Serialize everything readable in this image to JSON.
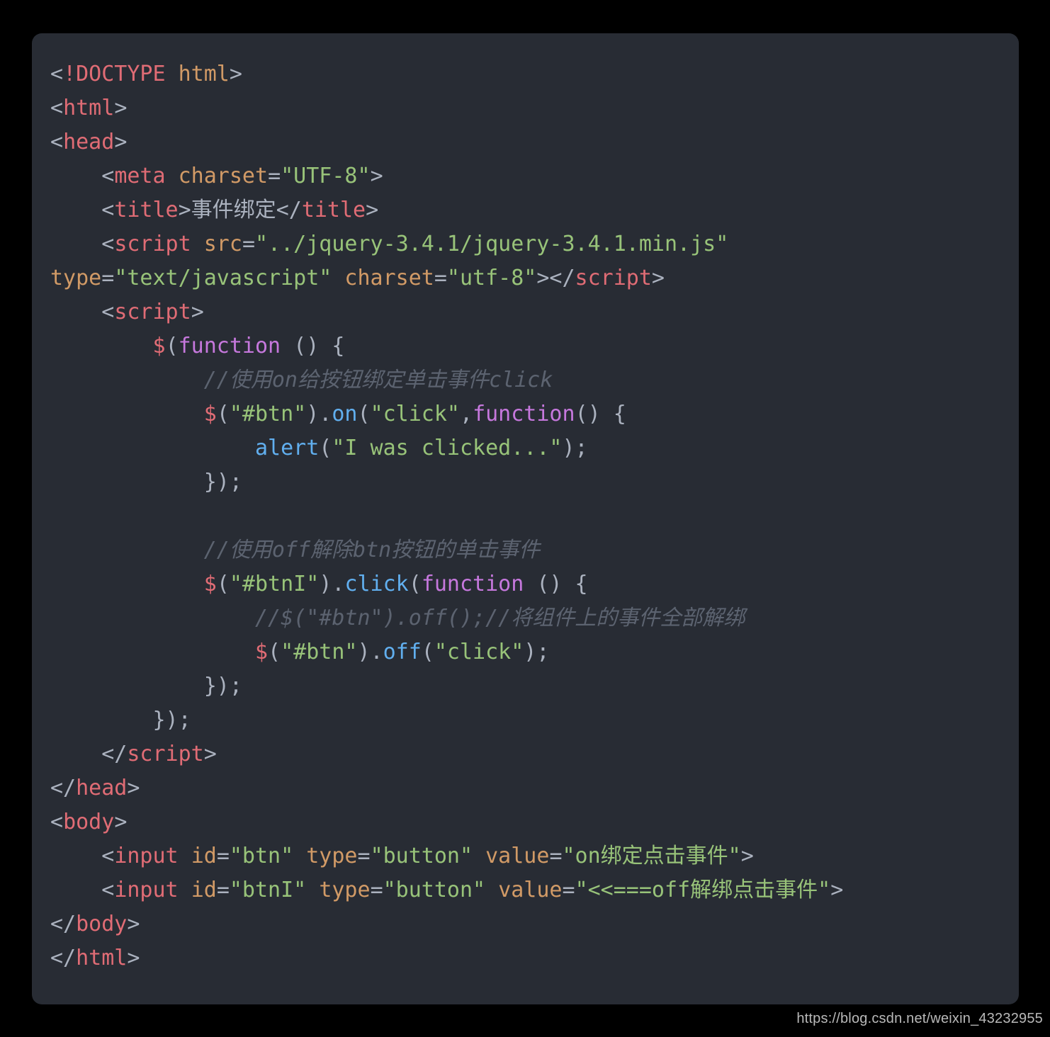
{
  "panel": {
    "background": "#282c34",
    "page_background": "#000000"
  },
  "theme": {
    "punctuation": "#abb2bf",
    "tag": "#e06c75",
    "attribute": "#d19a66",
    "string": "#98c379",
    "method": "#61afef",
    "keyword": "#c678dd",
    "comment": "#5c6370",
    "text": "#abb2bf"
  },
  "watermark": {
    "text": "https://blog.csdn.net/weixin_43232955"
  },
  "code": {
    "language": "html",
    "full_text": "<!DOCTYPE html>\n<html>\n<head>\n    <meta charset=\"UTF-8\">\n    <title>事件绑定</title>\n    <script src=\"../jquery-3.4.1/jquery-3.4.1.min.js\" type=\"text/javascript\" charset=\"utf-8\"></script>\n    <script>\n        $(function () {\n            //使用on给按钮绑定单击事件click\n            $(\"#btn\").on(\"click\",function() {\n                alert(\"I was clicked...\");\n            });\n\n            //使用off解除btn按钮的单击事件\n            $(\"#btnI\").click(function () {\n                //$(\"#btn\").off();//将组件上的事件全部解绑\n                $(\"#btn\").off(\"click\");\n            });\n        });\n    </script>\n</head>\n<body>\n    <input id=\"btn\" type=\"button\" value=\"on绑定点击事件\">\n    <input id=\"btnI\" type=\"button\" value=\"<<===off解绑点击事件\">\n</body>\n</html>",
    "lines": [
      {
        "id": "l1",
        "tokens": [
          {
            "t": "punct",
            "v": "<"
          },
          {
            "t": "tag",
            "v": "!DOCTYPE"
          },
          {
            "t": "txt",
            "v": " "
          },
          {
            "t": "attr",
            "v": "html"
          },
          {
            "t": "punct",
            "v": ">"
          }
        ]
      },
      {
        "id": "l2",
        "tokens": [
          {
            "t": "punct",
            "v": "<"
          },
          {
            "t": "tag",
            "v": "html"
          },
          {
            "t": "punct",
            "v": ">"
          }
        ]
      },
      {
        "id": "l3",
        "tokens": [
          {
            "t": "punct",
            "v": "<"
          },
          {
            "t": "tag",
            "v": "head"
          },
          {
            "t": "punct",
            "v": ">"
          }
        ]
      },
      {
        "id": "l4",
        "tokens": [
          {
            "t": "txt",
            "v": "    "
          },
          {
            "t": "punct",
            "v": "<"
          },
          {
            "t": "tag",
            "v": "meta"
          },
          {
            "t": "txt",
            "v": " "
          },
          {
            "t": "attr",
            "v": "charset"
          },
          {
            "t": "punct",
            "v": "="
          },
          {
            "t": "str",
            "v": "\"UTF-8\""
          },
          {
            "t": "punct",
            "v": ">"
          }
        ]
      },
      {
        "id": "l5",
        "tokens": [
          {
            "t": "txt",
            "v": "    "
          },
          {
            "t": "punct",
            "v": "<"
          },
          {
            "t": "tag",
            "v": "title"
          },
          {
            "t": "punct",
            "v": ">"
          },
          {
            "t": "txt",
            "v": "事件绑定"
          },
          {
            "t": "punct",
            "v": "</"
          },
          {
            "t": "tag",
            "v": "title"
          },
          {
            "t": "punct",
            "v": ">"
          }
        ]
      },
      {
        "id": "l6",
        "tokens": [
          {
            "t": "txt",
            "v": "    "
          },
          {
            "t": "punct",
            "v": "<"
          },
          {
            "t": "tag",
            "v": "script"
          },
          {
            "t": "txt",
            "v": " "
          },
          {
            "t": "attr",
            "v": "src"
          },
          {
            "t": "punct",
            "v": "="
          },
          {
            "t": "str",
            "v": "\"../jquery-3.4.1/jquery-3.4.1.min.js\""
          },
          {
            "t": "txt",
            "v": " "
          },
          {
            "t": "attr",
            "v": "type"
          },
          {
            "t": "punct",
            "v": "="
          },
          {
            "t": "str",
            "v": "\"text/javascript\""
          },
          {
            "t": "txt",
            "v": " "
          },
          {
            "t": "attr",
            "v": "charset"
          },
          {
            "t": "punct",
            "v": "="
          },
          {
            "t": "str",
            "v": "\"utf-8\""
          },
          {
            "t": "punct",
            "v": ">"
          },
          {
            "t": "punct",
            "v": "</"
          },
          {
            "t": "tag",
            "v": "script"
          },
          {
            "t": "punct",
            "v": ">"
          }
        ]
      },
      {
        "id": "l7",
        "tokens": [
          {
            "t": "txt",
            "v": "    "
          },
          {
            "t": "punct",
            "v": "<"
          },
          {
            "t": "tag",
            "v": "script"
          },
          {
            "t": "punct",
            "v": ">"
          }
        ]
      },
      {
        "id": "l8",
        "tokens": [
          {
            "t": "txt",
            "v": "        "
          },
          {
            "t": "sigil",
            "v": "$"
          },
          {
            "t": "punct",
            "v": "("
          },
          {
            "t": "kw",
            "v": "function"
          },
          {
            "t": "txt",
            "v": " "
          },
          {
            "t": "punct",
            "v": "() {"
          }
        ]
      },
      {
        "id": "l9",
        "tokens": [
          {
            "t": "txt",
            "v": "            "
          },
          {
            "t": "cmt",
            "v": "//使用on给按钮绑定单击事件click"
          }
        ]
      },
      {
        "id": "l10",
        "tokens": [
          {
            "t": "txt",
            "v": "            "
          },
          {
            "t": "sigil",
            "v": "$"
          },
          {
            "t": "punct",
            "v": "("
          },
          {
            "t": "str",
            "v": "\"#btn\""
          },
          {
            "t": "punct",
            "v": ")."
          },
          {
            "t": "method",
            "v": "on"
          },
          {
            "t": "punct",
            "v": "("
          },
          {
            "t": "str",
            "v": "\"click\""
          },
          {
            "t": "punct",
            "v": ","
          },
          {
            "t": "kw",
            "v": "function"
          },
          {
            "t": "punct",
            "v": "() {"
          }
        ]
      },
      {
        "id": "l11",
        "tokens": [
          {
            "t": "txt",
            "v": "                "
          },
          {
            "t": "method",
            "v": "alert"
          },
          {
            "t": "punct",
            "v": "("
          },
          {
            "t": "str",
            "v": "\"I was clicked...\""
          },
          {
            "t": "punct",
            "v": ");"
          }
        ]
      },
      {
        "id": "l12",
        "tokens": [
          {
            "t": "txt",
            "v": "            "
          },
          {
            "t": "punct",
            "v": "});"
          }
        ]
      },
      {
        "id": "l13",
        "tokens": []
      },
      {
        "id": "l14",
        "tokens": [
          {
            "t": "txt",
            "v": "            "
          },
          {
            "t": "cmt",
            "v": "//使用off解除btn按钮的单击事件"
          }
        ]
      },
      {
        "id": "l15",
        "tokens": [
          {
            "t": "txt",
            "v": "            "
          },
          {
            "t": "sigil",
            "v": "$"
          },
          {
            "t": "punct",
            "v": "("
          },
          {
            "t": "str",
            "v": "\"#btnI\""
          },
          {
            "t": "punct",
            "v": ")."
          },
          {
            "t": "method",
            "v": "click"
          },
          {
            "t": "punct",
            "v": "("
          },
          {
            "t": "kw",
            "v": "function"
          },
          {
            "t": "txt",
            "v": " "
          },
          {
            "t": "punct",
            "v": "() {"
          }
        ]
      },
      {
        "id": "l16",
        "tokens": [
          {
            "t": "txt",
            "v": "                "
          },
          {
            "t": "cmt",
            "v": "//$(\"#btn\").off();//将组件上的事件全部解绑"
          }
        ]
      },
      {
        "id": "l17",
        "tokens": [
          {
            "t": "txt",
            "v": "                "
          },
          {
            "t": "sigil",
            "v": "$"
          },
          {
            "t": "punct",
            "v": "("
          },
          {
            "t": "str",
            "v": "\"#btn\""
          },
          {
            "t": "punct",
            "v": ")."
          },
          {
            "t": "method",
            "v": "off"
          },
          {
            "t": "punct",
            "v": "("
          },
          {
            "t": "str",
            "v": "\"click\""
          },
          {
            "t": "punct",
            "v": ");"
          }
        ]
      },
      {
        "id": "l18",
        "tokens": [
          {
            "t": "txt",
            "v": "            "
          },
          {
            "t": "punct",
            "v": "});"
          }
        ]
      },
      {
        "id": "l19",
        "tokens": [
          {
            "t": "txt",
            "v": "        "
          },
          {
            "t": "punct",
            "v": "});"
          }
        ]
      },
      {
        "id": "l20",
        "tokens": [
          {
            "t": "txt",
            "v": "    "
          },
          {
            "t": "punct",
            "v": "</"
          },
          {
            "t": "tag",
            "v": "script"
          },
          {
            "t": "punct",
            "v": ">"
          }
        ]
      },
      {
        "id": "l21",
        "tokens": [
          {
            "t": "punct",
            "v": "</"
          },
          {
            "t": "tag",
            "v": "head"
          },
          {
            "t": "punct",
            "v": ">"
          }
        ]
      },
      {
        "id": "l22",
        "tokens": [
          {
            "t": "punct",
            "v": "<"
          },
          {
            "t": "tag",
            "v": "body"
          },
          {
            "t": "punct",
            "v": ">"
          }
        ]
      },
      {
        "id": "l23",
        "tokens": [
          {
            "t": "txt",
            "v": "    "
          },
          {
            "t": "punct",
            "v": "<"
          },
          {
            "t": "tag",
            "v": "input"
          },
          {
            "t": "txt",
            "v": " "
          },
          {
            "t": "attr",
            "v": "id"
          },
          {
            "t": "punct",
            "v": "="
          },
          {
            "t": "str",
            "v": "\"btn\""
          },
          {
            "t": "txt",
            "v": " "
          },
          {
            "t": "attr",
            "v": "type"
          },
          {
            "t": "punct",
            "v": "="
          },
          {
            "t": "str",
            "v": "\"button\""
          },
          {
            "t": "txt",
            "v": " "
          },
          {
            "t": "attr",
            "v": "value"
          },
          {
            "t": "punct",
            "v": "="
          },
          {
            "t": "str",
            "v": "\"on绑定点击事件\""
          },
          {
            "t": "punct",
            "v": ">"
          }
        ]
      },
      {
        "id": "l24",
        "tokens": [
          {
            "t": "txt",
            "v": "    "
          },
          {
            "t": "punct",
            "v": "<"
          },
          {
            "t": "tag",
            "v": "input"
          },
          {
            "t": "txt",
            "v": " "
          },
          {
            "t": "attr",
            "v": "id"
          },
          {
            "t": "punct",
            "v": "="
          },
          {
            "t": "str",
            "v": "\"btnI\""
          },
          {
            "t": "txt",
            "v": " "
          },
          {
            "t": "attr",
            "v": "type"
          },
          {
            "t": "punct",
            "v": "="
          },
          {
            "t": "str",
            "v": "\"button\""
          },
          {
            "t": "txt",
            "v": " "
          },
          {
            "t": "attr",
            "v": "value"
          },
          {
            "t": "punct",
            "v": "="
          },
          {
            "t": "str",
            "v": "\"<<===off解绑点击事件\""
          },
          {
            "t": "punct",
            "v": ">"
          }
        ]
      },
      {
        "id": "l25",
        "tokens": [
          {
            "t": "punct",
            "v": "</"
          },
          {
            "t": "tag",
            "v": "body"
          },
          {
            "t": "punct",
            "v": ">"
          }
        ]
      },
      {
        "id": "l26",
        "tokens": [
          {
            "t": "punct",
            "v": "</"
          },
          {
            "t": "tag",
            "v": "html"
          },
          {
            "t": "punct",
            "v": ">"
          }
        ]
      }
    ]
  }
}
